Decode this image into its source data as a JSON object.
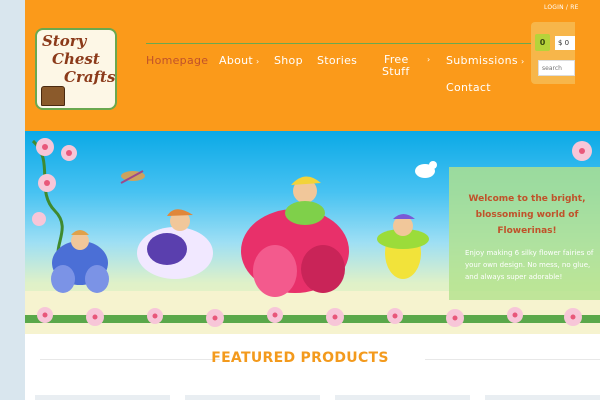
{
  "top_links": "LOGIN / RE",
  "logo": {
    "text_lines": [
      "Story",
      "Chest",
      "Crafts"
    ]
  },
  "nav": {
    "items": [
      {
        "label": "Homepage",
        "chevron": ""
      },
      {
        "label": "About",
        "chevron": "›"
      },
      {
        "label": "Shop",
        "chevron": ""
      },
      {
        "label": "Stories",
        "chevron": ""
      },
      {
        "label": "Free",
        "label2": "Stuff",
        "chevron": "›"
      },
      {
        "label": "Submissions",
        "chevron": "›"
      },
      {
        "label": "Contact",
        "chevron": ""
      }
    ]
  },
  "cart": {
    "count": "0",
    "total": "$ 0"
  },
  "search": {
    "placeholder": "search"
  },
  "banner": {
    "heading": "Welcome to the bright, blossoming world of Flowerinas!",
    "body": "Enjoy making 6 silky flower fairies of your own design. No mess, no glue, and always super adorable!"
  },
  "featured": {
    "title": "FEATURED PRODUCTS"
  },
  "colors": {
    "header": "#fb9a1a",
    "accent_green": "#6aa84f",
    "active": "#c0522a",
    "featured": "#f39a1d"
  }
}
